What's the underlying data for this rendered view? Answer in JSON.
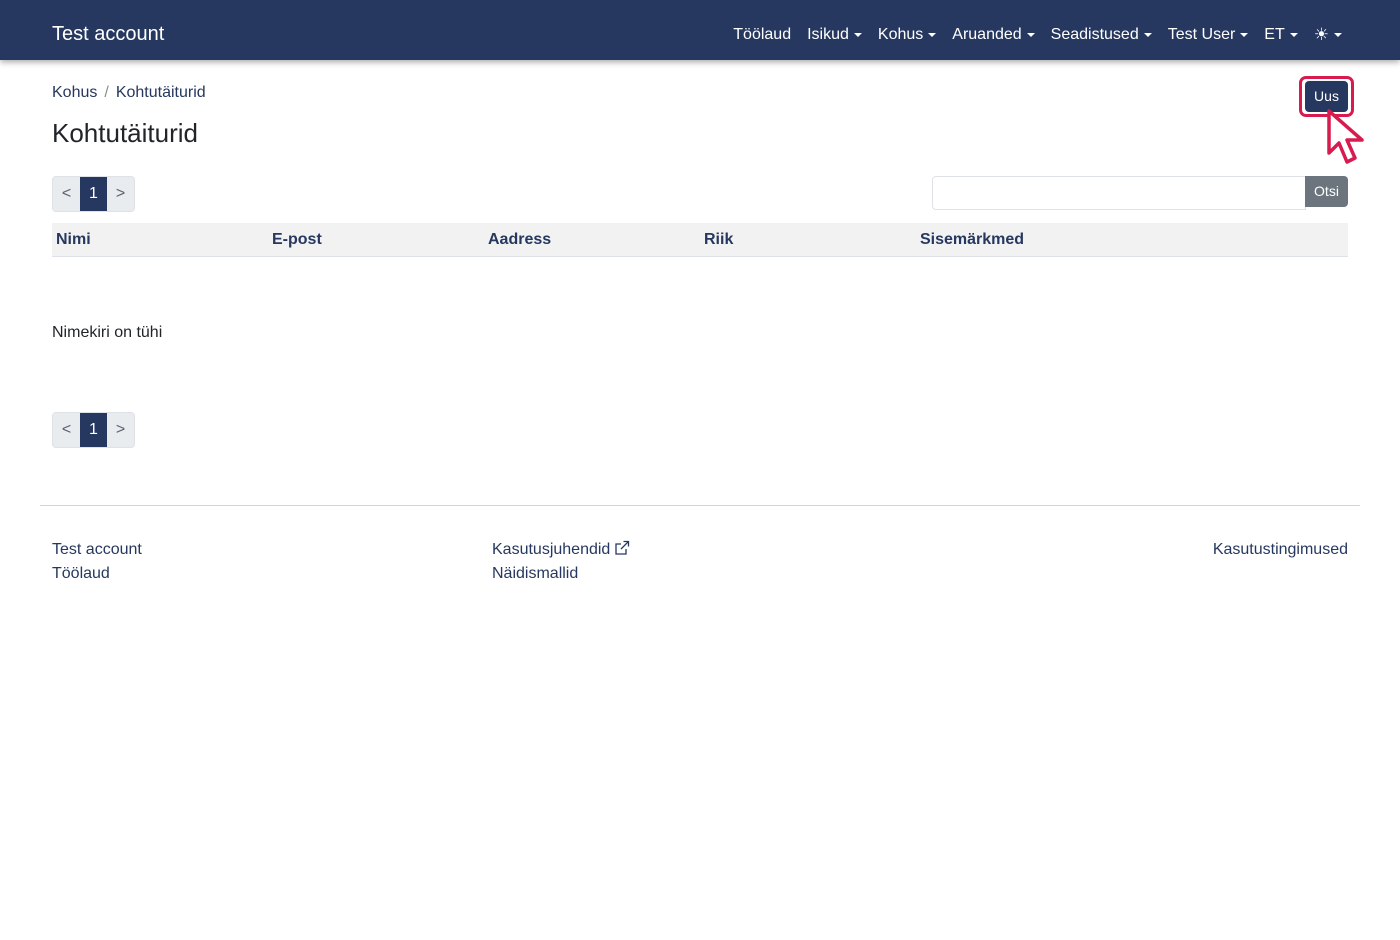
{
  "navbar": {
    "brand": "Test account",
    "items": [
      {
        "label": "Töölaud",
        "dropdown": false
      },
      {
        "label": "Isikud",
        "dropdown": true
      },
      {
        "label": "Kohus",
        "dropdown": true
      },
      {
        "label": "Aruanded",
        "dropdown": true
      },
      {
        "label": "Seadistused",
        "dropdown": true
      },
      {
        "label": "Test User",
        "dropdown": true
      },
      {
        "label": "ET",
        "dropdown": true
      }
    ],
    "theme_icon": "sun-icon",
    "theme_glyph": "☀"
  },
  "breadcrumb": {
    "items": [
      "Kohus",
      "Kohtutäiturid"
    ],
    "separator": "/"
  },
  "page": {
    "title": "Kohtutäiturid",
    "new_button": "Uus"
  },
  "pagination": {
    "prev": "<",
    "current": "1",
    "next": ">"
  },
  "search": {
    "value": "",
    "placeholder": "",
    "button": "Otsi"
  },
  "table": {
    "columns": [
      "Nimi",
      "E-post",
      "Aadress",
      "Riik",
      "Sisemärkmed"
    ],
    "rows": [],
    "empty_message": "Nimekiri on tühi"
  },
  "footer": {
    "col1": [
      "Test account",
      "Töölaud"
    ],
    "col2": [
      "Kasutusjuhendid",
      "Näidismallid"
    ],
    "col3": [
      "Kasutustingimused"
    ]
  },
  "colors": {
    "primary": "#26385f",
    "highlight": "#d81b4f",
    "secondary_button": "#6c757d"
  }
}
